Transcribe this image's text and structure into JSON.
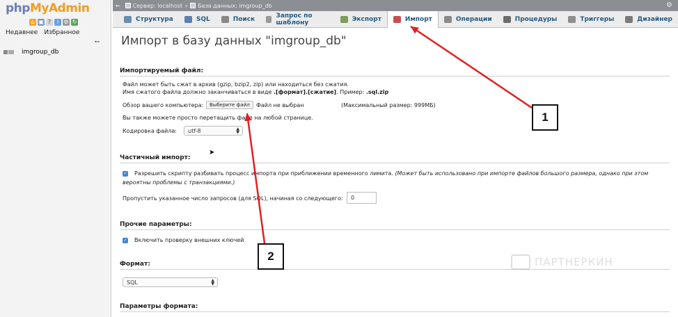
{
  "sidebar": {
    "logo_php": "php",
    "logo_admin": "MyAdmin",
    "tab_recent": "Недавнее",
    "tab_favorites": "Избранное",
    "db_name": "imgroup_db"
  },
  "topbar": {
    "server_label": "Сервер: localhost",
    "separator": "»",
    "db_label": "База данных: imgroup_db"
  },
  "menu": {
    "tabs": [
      {
        "label": "Структура",
        "icon": "structure-icon",
        "color": "#6a8caf"
      },
      {
        "label": "SQL",
        "icon": "sql-icon",
        "color": "#5a7fb0"
      },
      {
        "label": "Поиск",
        "icon": "search-icon",
        "color": "#888888"
      },
      {
        "label": "Запрос по шаблону",
        "icon": "query-icon",
        "color": "#999999"
      },
      {
        "label": "Экспорт",
        "icon": "export-icon",
        "color": "#7f9c5a"
      },
      {
        "label": "Импорт",
        "icon": "import-icon",
        "color": "#c94f4f"
      },
      {
        "label": "Операции",
        "icon": "wrench-icon",
        "color": "#8a8a8a"
      },
      {
        "label": "Процедуры",
        "icon": "routines-icon",
        "color": "#6b6b6b"
      },
      {
        "label": "Триггеры",
        "icon": "triggers-icon",
        "color": "#8e8e8e"
      },
      {
        "label": "Дизайнер",
        "icon": "designer-icon",
        "color": "#7a7a7a"
      }
    ],
    "active_index": 5
  },
  "page": {
    "title": "Импорт в базу данных \"imgroup_db\""
  },
  "file_section": {
    "heading": "Импортируемый файл:",
    "line1": "Файл может быть сжат в архив (gzip, bzip2, zip) или находиться без сжатия.",
    "line2_prefix": "Имя сжатого файла должно заканчиваться в виде ",
    "line2_format": ".[формат].[сжатие]",
    "line2_mid": ". Пример: ",
    "line2_example": ".sql.zip",
    "browse_label": "Обзор вашего компьютера:",
    "choose_button": "Выберите файл",
    "no_file": "Файл не выбран",
    "max_size": "(Максимальный размер: 999МБ)",
    "drag_hint": "Вы также можете просто перетащить файл на любой странице.",
    "encoding_label": "Кодировка файла:",
    "encoding_value": "utf-8"
  },
  "partial_section": {
    "heading": "Частичный импорт:",
    "allow_interrupt_text": "Разрешить скрипту разбивать процесс импорта при приближении временного лимита.",
    "allow_interrupt_note_1": "(Может быть использовано при импорте файлов большого размера, однако при этом",
    "allow_interrupt_note_2": "вероятны проблемы с транзакциями.)",
    "skip_label": "Пропустить указанное число запросов (для SQL), начиная со следующего:",
    "skip_value": "0"
  },
  "other_section": {
    "heading": "Прочие параметры:",
    "fk_checks_label": "Включить проверку внешних ключей"
  },
  "format_section": {
    "heading": "Формат:",
    "format_value": "SQL"
  },
  "format_options_section": {
    "heading": "Параметры формата:"
  },
  "annotations": {
    "callout_1": "1",
    "callout_2": "2",
    "arrow_color": "#e02020",
    "watermark_text": "ПАРТНЕРКИН"
  }
}
